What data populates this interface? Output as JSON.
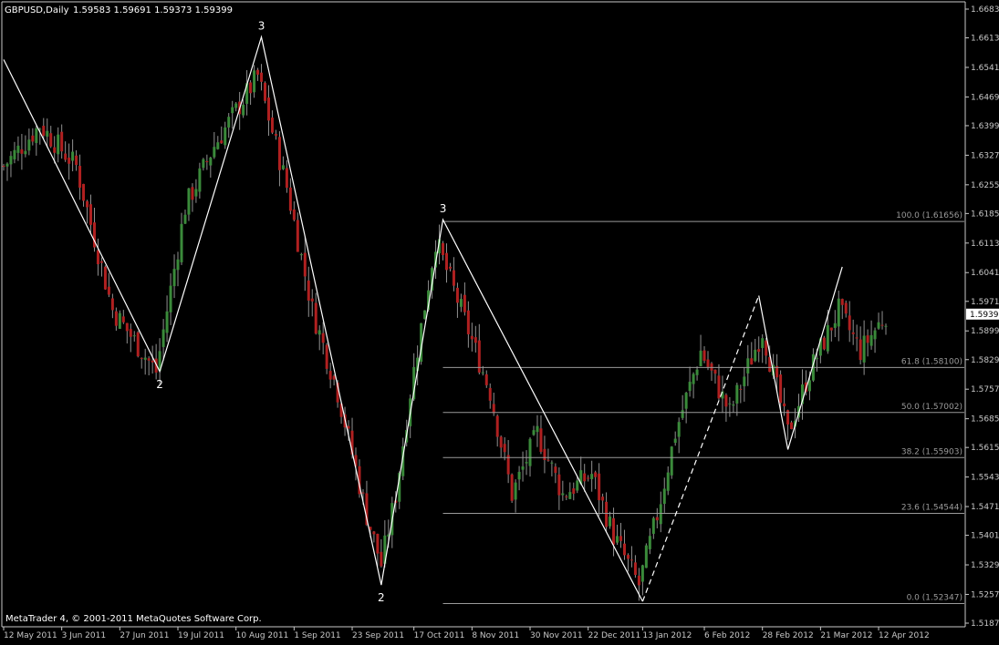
{
  "window": {
    "title": "GBPUSD,Daily",
    "ohlc": "1.59583 1.59691 1.59373 1.59399",
    "copyright": "MetaTrader 4, © 2001-2011 MetaQuotes Software Corp.",
    "current_price": "1.59399"
  },
  "colors": {
    "background": "#000000",
    "bull": "#3a8a3a",
    "bear": "#b02020",
    "wick": "#909090",
    "axis": "#c8c8c8",
    "fib": "#9a9a9a",
    "wave": "#ffffff",
    "price_tag_bg": "#ffffff",
    "price_tag_fg": "#000000"
  },
  "chart_data": {
    "type": "candlestick",
    "ylim": [
      1.5187,
      1.6683
    ],
    "y_ticks": [
      "1.66830",
      "1.66130",
      "1.65410",
      "1.64690",
      "1.63990",
      "1.63270",
      "1.62550",
      "1.61850",
      "1.61130",
      "1.60410",
      "1.59710",
      "1.58990",
      "1.58290",
      "1.57570",
      "1.56850",
      "1.56150",
      "1.55430",
      "1.54710",
      "1.54010",
      "1.53290",
      "1.52570",
      "1.51870"
    ],
    "x_ticks": [
      {
        "label": "12 May 2011",
        "i": 0
      },
      {
        "label": "3 Jun 2011",
        "i": 16
      },
      {
        "label": "27 Jun 2011",
        "i": 32
      },
      {
        "label": "19 Jul 2011",
        "i": 48
      },
      {
        "label": "10 Aug 2011",
        "i": 64
      },
      {
        "label": "1 Sep 2011",
        "i": 80
      },
      {
        "label": "23 Sep 2011",
        "i": 96
      },
      {
        "label": "17 Oct 2011",
        "i": 113
      },
      {
        "label": "8 Nov 2011",
        "i": 129
      },
      {
        "label": "30 Nov 2011",
        "i": 145
      },
      {
        "label": "22 Dec 2011",
        "i": 161
      },
      {
        "label": "13 Jan 2012",
        "i": 176
      },
      {
        "label": "6 Feb 2012",
        "i": 193
      },
      {
        "label": "28 Feb 2012",
        "i": 209
      },
      {
        "label": "21 Mar 2012",
        "i": 225
      },
      {
        "label": "12 Apr 2012",
        "i": 241
      }
    ],
    "bar_count": 244,
    "key_closes": [
      [
        0,
        1.63
      ],
      [
        10,
        1.64
      ],
      [
        20,
        1.63
      ],
      [
        30,
        1.595
      ],
      [
        42,
        1.58
      ],
      [
        50,
        1.62
      ],
      [
        58,
        1.635
      ],
      [
        70,
        1.652
      ],
      [
        78,
        1.625
      ],
      [
        85,
        1.595
      ],
      [
        92,
        1.575
      ],
      [
        100,
        1.545
      ],
      [
        104,
        1.533
      ],
      [
        108,
        1.55
      ],
      [
        112,
        1.575
      ],
      [
        119,
        1.612
      ],
      [
        126,
        1.595
      ],
      [
        134,
        1.575
      ],
      [
        140,
        1.55
      ],
      [
        147,
        1.565
      ],
      [
        154,
        1.55
      ],
      [
        162,
        1.555
      ],
      [
        168,
        1.54
      ],
      [
        175,
        1.528
      ],
      [
        180,
        1.545
      ],
      [
        185,
        1.565
      ],
      [
        192,
        1.585
      ],
      [
        200,
        1.57
      ],
      [
        209,
        1.59
      ],
      [
        216,
        1.565
      ],
      [
        222,
        1.58
      ],
      [
        230,
        1.595
      ],
      [
        236,
        1.585
      ],
      [
        243,
        1.594
      ]
    ],
    "wave_lines": [
      {
        "points": [
          [
            0,
            1.656
          ],
          [
            43,
            1.58
          ],
          [
            71,
            1.6615
          ],
          [
            104,
            1.528
          ],
          [
            121,
            1.617
          ],
          [
            176,
            1.524
          ]
        ],
        "style": "solid"
      },
      {
        "points": [
          [
            176,
            1.524
          ],
          [
            208,
            1.5985
          ]
        ],
        "style": "dashed"
      },
      {
        "points": [
          [
            208,
            1.5985
          ],
          [
            216,
            1.561
          ],
          [
            231,
            1.6055
          ]
        ],
        "style": "solid"
      }
    ],
    "wave_labels": [
      {
        "text": "3",
        "i": 71,
        "price": 1.6615,
        "pos": "above"
      },
      {
        "text": "2",
        "i": 43,
        "price": 1.58,
        "pos": "below"
      },
      {
        "text": "2",
        "i": 104,
        "price": 1.528,
        "pos": "below"
      },
      {
        "text": "3",
        "i": 121,
        "price": 1.617,
        "pos": "above"
      }
    ],
    "fibonacci": {
      "start_i": 121,
      "levels": [
        {
          "label": "100.0 (1.61656)",
          "price": 1.61656
        },
        {
          "label": "61.8 (1.58100)",
          "price": 1.581
        },
        {
          "label": "50.0 (1.57002)",
          "price": 1.57002
        },
        {
          "label": "38.2 (1.55903)",
          "price": 1.55903
        },
        {
          "label": "23.6 (1.54544)",
          "price": 1.54544
        },
        {
          "label": "0.0 (1.52347)",
          "price": 1.52347
        }
      ]
    }
  }
}
